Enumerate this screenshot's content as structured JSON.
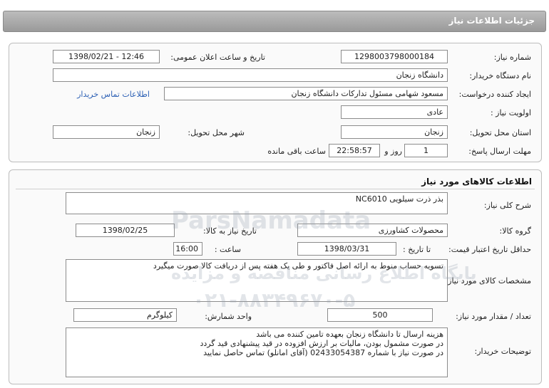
{
  "header": {
    "title": "جزئیات اطلاعات نیاز"
  },
  "need_info": {
    "need_number_label": "شماره نیاز:",
    "need_number": "1298003798000184",
    "announce_label": "تاریخ و ساعت اعلان عمومی:",
    "announce_value": "1398/02/21 - 12:46",
    "buyer_org_label": "نام دستگاه خریدار:",
    "buyer_org": "دانشگاه زنجان",
    "requester_label": "ایجاد کننده درخواست:",
    "requester": "مسعود شهامی مسئول تدارکات دانشگاه زنجان",
    "contact_link": "اطلاعات تماس خریدار",
    "priority_label": "اولویت نیاز :",
    "priority": "عادی",
    "province_label": "استان محل تحویل:",
    "province": "زنجان",
    "city_label": "شهر محل تحویل:",
    "city": "زنجان",
    "deadline_label": "مهلت ارسال پاسخ:",
    "deadline_days": "1",
    "days_label": "روز و",
    "deadline_time": "22:58:57",
    "remaining_label": "ساعت باقی مانده"
  },
  "goods": {
    "section_title": "اطلاعات کالاهای مورد نیاز",
    "summary_label": "شرح کلی نیاز:",
    "summary": "بذر ذرت سیلویی NC6010",
    "group_label": "گروه کالا:",
    "group": "محصولات کشاورزی",
    "need_date_label": "تاریخ نیاز به کالا:",
    "need_date": "1398/02/25",
    "validity_label": "حداقل تاریخ اعتبار قیمت:",
    "until_date_label": "تا تاریخ :",
    "validity_date": "1398/03/31",
    "time_label": "ساعت :",
    "validity_time": "16:00",
    "specs_label": "مشخصات کالای مورد نیاز:",
    "specs": "تسویه حساب منوط به ارائه اصل فاکتور و طی یک هفته پس از دریافت کالا صورت میگیرد",
    "quantity_label": "تعداد / مقدار مورد نیاز:",
    "quantity": "500",
    "unit_label": "واحد شمارش:",
    "unit": "کیلوگرم",
    "buyer_notes_label": "توضیحات خریدار:",
    "buyer_notes": "هزینه ارسال تا دانشگاه زنجان بعهده تامین کننده می باشد\nدر صورت مشمول بودن، مالیات بر ارزش افزوده در قید پیشنهادی قید گردد\nدر صورت نیاز با شماره 02433054387 (آقای امانلو) تماس حاصل نمایید"
  },
  "watermark": {
    "line1": "پایگاه اطلاع رسانی مناقصه و مزایده",
    "line2": "۰۲۱-۸۸۳۴۹۶۷۰-۵",
    "brand": "ParsNamadata"
  }
}
